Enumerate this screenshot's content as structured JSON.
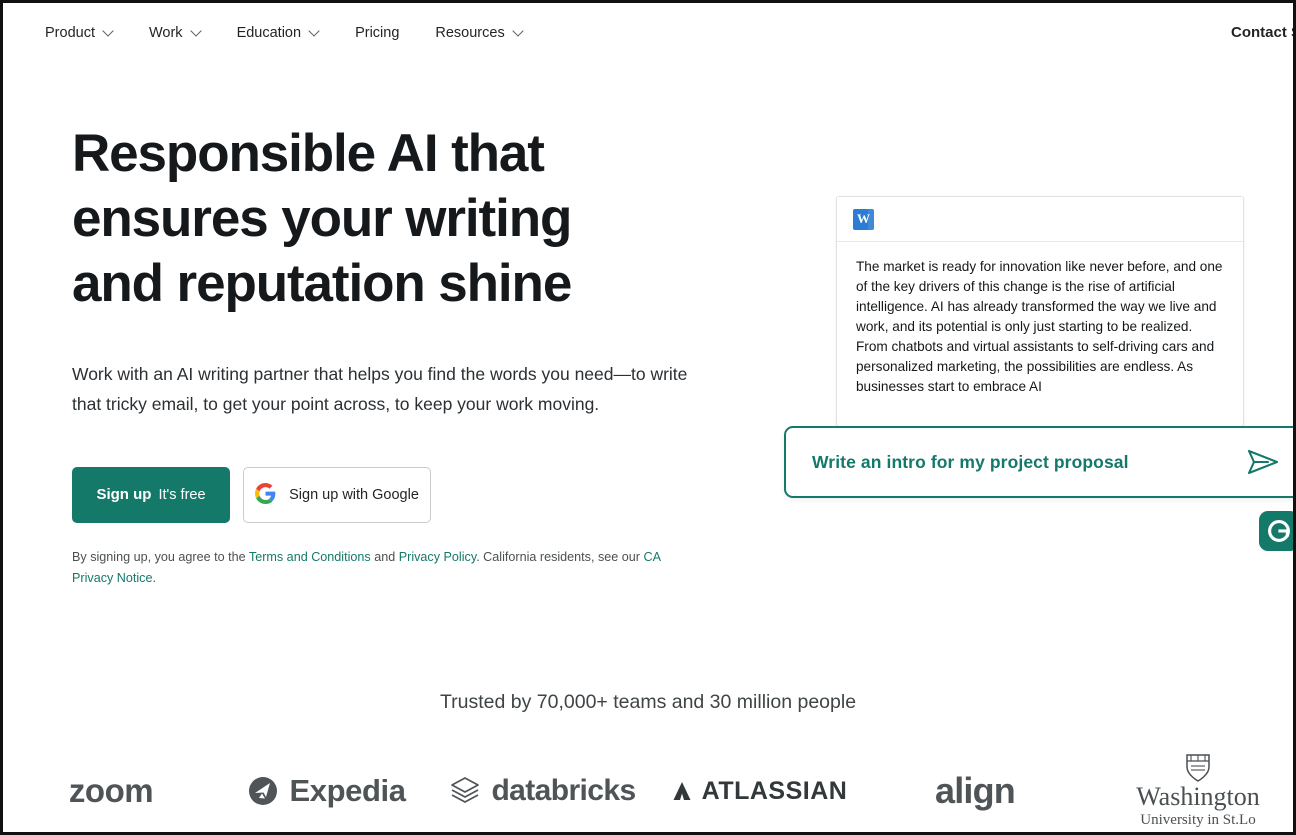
{
  "nav": {
    "items": [
      {
        "label": "Product",
        "has_chevron": true
      },
      {
        "label": "Work",
        "has_chevron": true
      },
      {
        "label": "Education",
        "has_chevron": true
      },
      {
        "label": "Pricing",
        "has_chevron": false
      },
      {
        "label": "Resources",
        "has_chevron": true
      }
    ],
    "right_label": "Contact S"
  },
  "hero": {
    "headline": "Responsible AI that ensures your writing and reputation shine",
    "subhead": "Work with an AI writing partner that helps you find the words you need—to write that tricky email, to get your point across, to keep your work moving.",
    "signup_strong": "Sign up",
    "signup_light": "It's free",
    "google_label": "Sign up with Google",
    "legal_prefix": "By signing up, you agree to the ",
    "legal_terms": "Terms and Conditions",
    "legal_mid": " and ",
    "legal_privacy": "Privacy Policy",
    "legal_suffix": ". California residents, see our ",
    "legal_ca": "CA Privacy Notice",
    "legal_end": "."
  },
  "document": {
    "app_icon": "microsoft-word-icon",
    "icon_letter": "W",
    "body_text": "The market is ready for innovation like never before, and one of the key drivers of this change is the rise of artificial intelligence. AI has already transformed the way we live and work, and its potential is only just starting to be realized. From chatbots and virtual assistants to self-driving cars and personalized marketing, the possibilities are endless. As businesses start to embrace AI"
  },
  "prompt": {
    "text": "Write an intro for my project proposal",
    "send_icon": "send-paper-plane-icon"
  },
  "badge": {
    "icon": "grammarly-logo-icon",
    "letter": "G"
  },
  "trust": {
    "text": "Trusted by 70,000+ teams and 30 million people",
    "logos": [
      {
        "name": "zoom",
        "label": "zoom"
      },
      {
        "name": "expedia",
        "label": "Expedia"
      },
      {
        "name": "databricks",
        "label": "databricks"
      },
      {
        "name": "atlassian",
        "label": "ATLASSIAN"
      },
      {
        "name": "align",
        "label": "align"
      },
      {
        "name": "washington-university",
        "label": "Washington",
        "sublabel": "University in St.Lo"
      }
    ]
  },
  "colors": {
    "brand_green": "#15796a",
    "text_dark": "#16191c",
    "text_muted": "#4b5053",
    "word_blue": "#2b7cd3"
  }
}
